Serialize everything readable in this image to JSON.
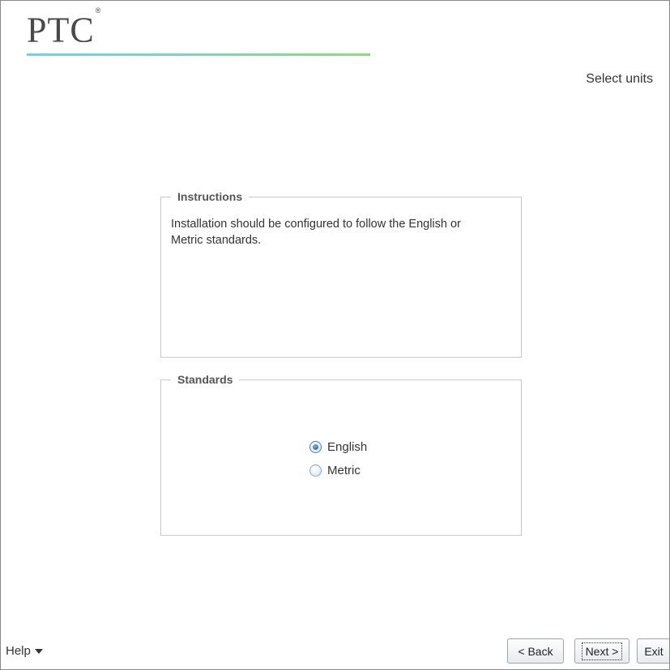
{
  "brand": {
    "logo_text": "PTC",
    "trademark": "®"
  },
  "header": {
    "step_title": "Select units"
  },
  "instructions": {
    "legend": "Instructions",
    "text": "Installation should be configured to follow the English or Metric standards."
  },
  "standards": {
    "legend": "Standards",
    "options": [
      {
        "label": "English",
        "selected": true
      },
      {
        "label": "Metric",
        "selected": false
      }
    ]
  },
  "footer": {
    "help_label": "Help",
    "back_label": "< Back",
    "next_label": "Next >",
    "exit_label": "Exit"
  },
  "colors": {
    "logo_rule_start": "#7fcbe0",
    "logo_rule_end": "#9bd08c",
    "radio_selected": "#2f6bb5"
  }
}
